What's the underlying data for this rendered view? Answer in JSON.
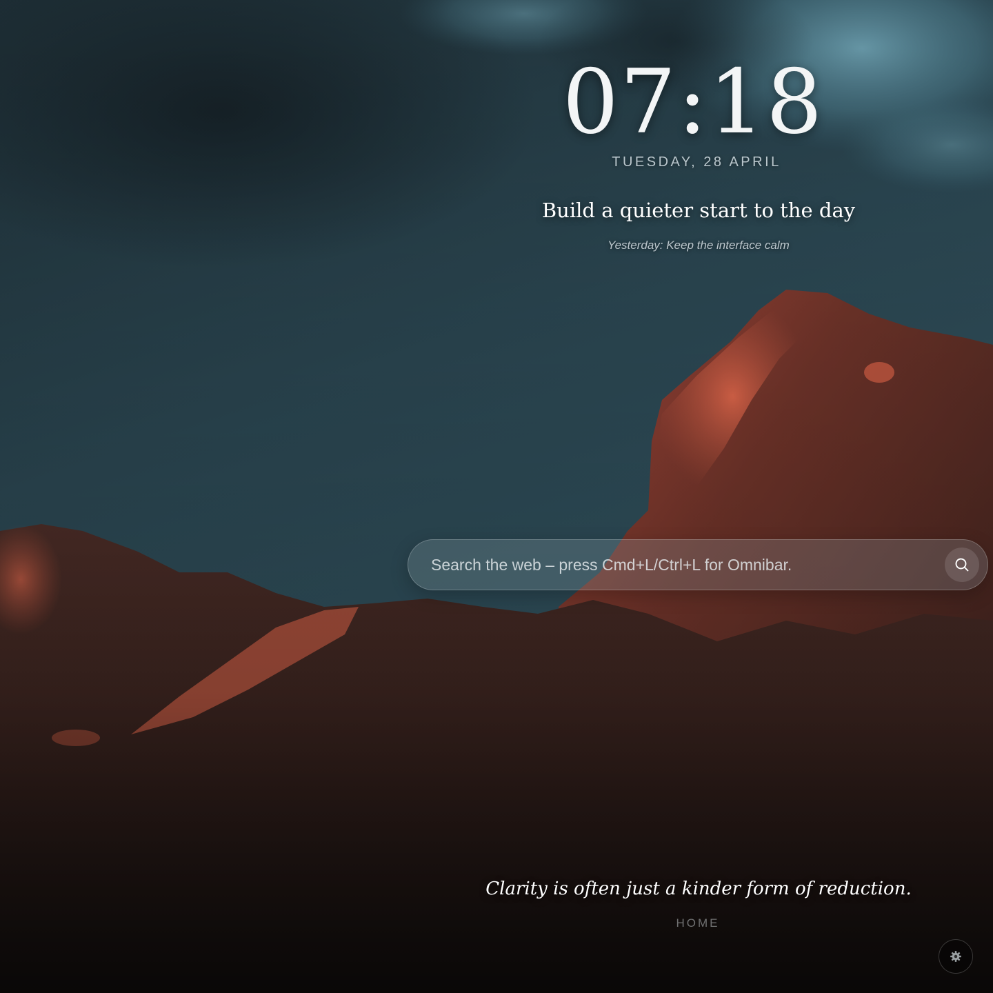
{
  "background": {
    "scene": "dark teal cloudy sky over red rock mountains at dusk",
    "sky_color": "#2b4650",
    "rock_color": "#3c2622",
    "lit_rock_color": "#c4573f"
  },
  "clock": {
    "time": "07:18",
    "date": "TUESDAY, 28 APRIL"
  },
  "focus": {
    "title": "Build a quieter start to the day",
    "yesterday": "Yesterday: Keep the interface calm"
  },
  "search": {
    "placeholder": "Search the web – press Cmd+L/Ctrl+L for Omnibar.",
    "icon": "search-icon"
  },
  "quote": {
    "text": "Clarity is often just a kinder form of reduction."
  },
  "footer": {
    "label": "HOME",
    "settings_icon": "gear-icon"
  },
  "colors": {
    "text": "#ffffff",
    "muted": "#c8cdd0"
  }
}
